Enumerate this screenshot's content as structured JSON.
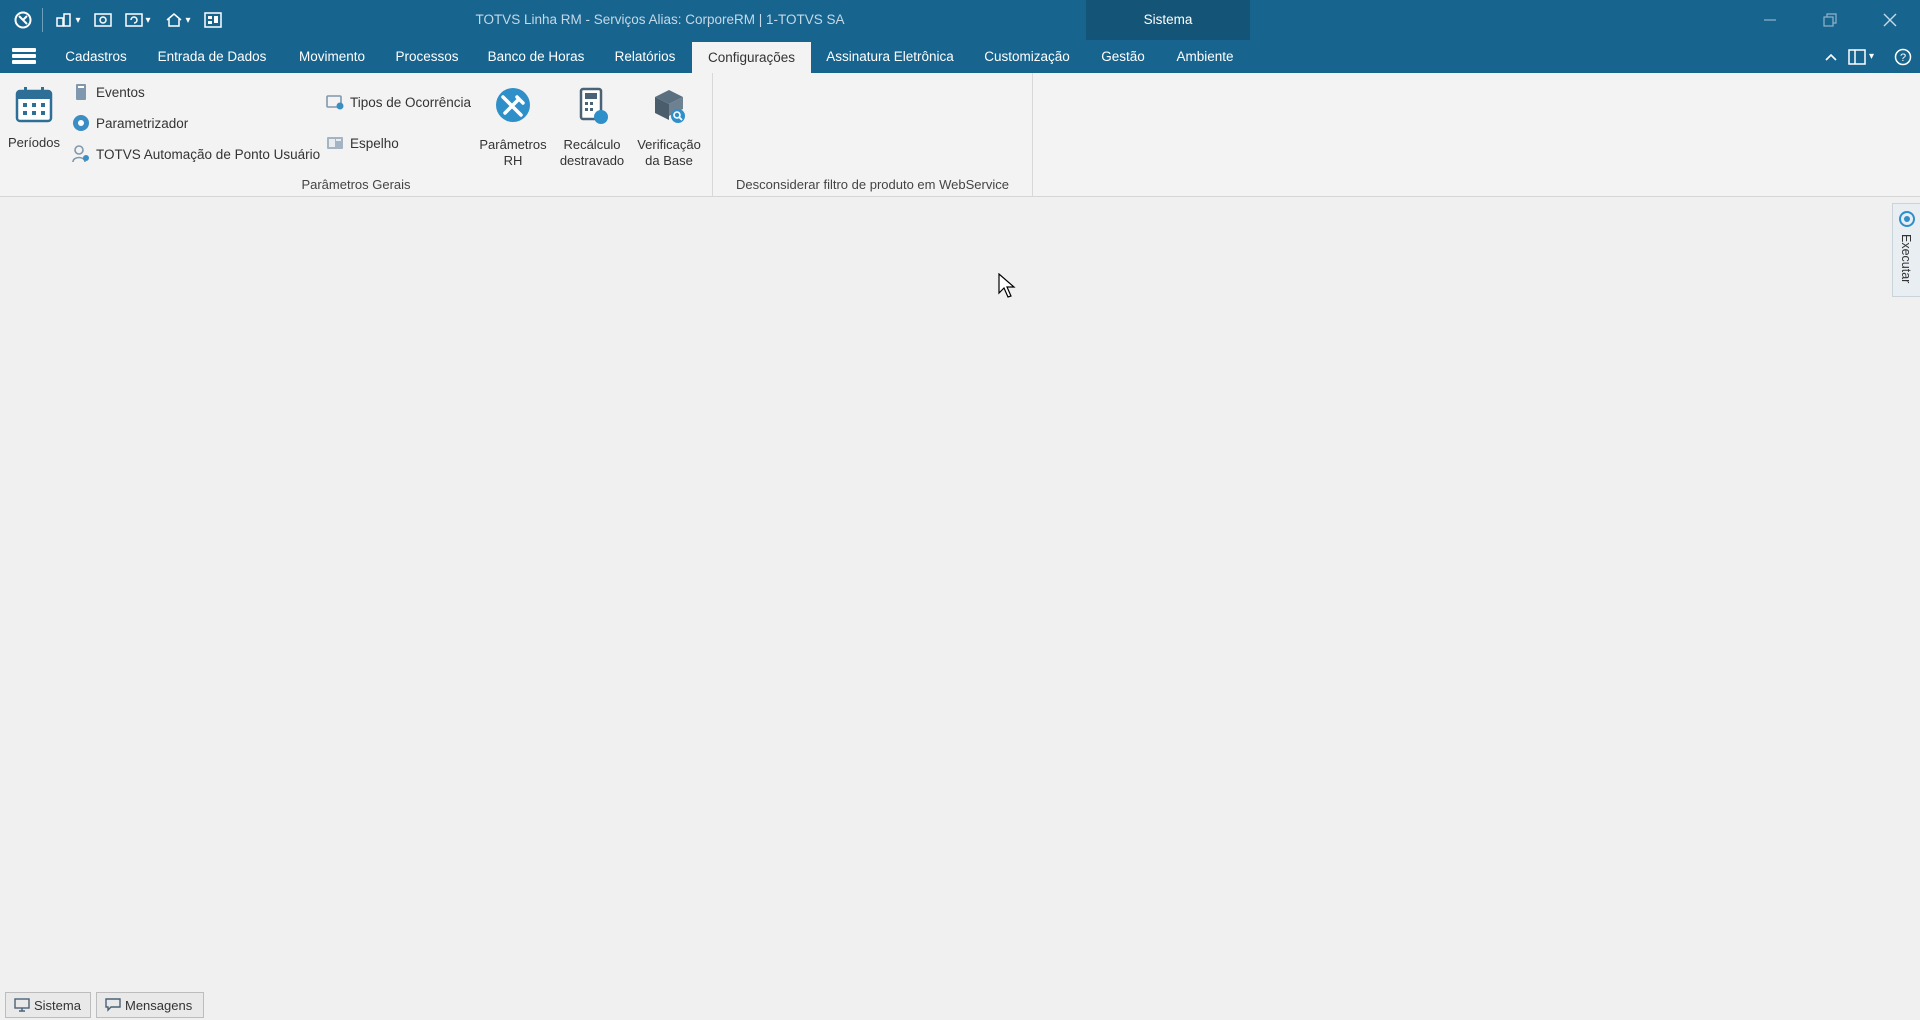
{
  "window": {
    "title": "TOTVS Linha RM - Serviços  Alias: CorporeRM | 1-TOTVS SA",
    "context_group": "Sistema"
  },
  "tabs": [
    {
      "label": "Cadastros"
    },
    {
      "label": "Entrada de Dados"
    },
    {
      "label": "Movimento"
    },
    {
      "label": "Processos"
    },
    {
      "label": "Banco de Horas"
    },
    {
      "label": "Relatórios"
    },
    {
      "label": "Configurações",
      "active": true
    },
    {
      "label": "Assinatura Eletrônica"
    },
    {
      "label": "Customização"
    },
    {
      "label": "Gestão"
    },
    {
      "label": "Ambiente"
    }
  ],
  "ribbon": {
    "periodos": "Períodos",
    "eventos": "Eventos",
    "parametrizador": "Parametrizador",
    "automacao": "TOTVS Automação de Ponto Usuário",
    "tipos_ocorrencia": "Tipos de Ocorrência",
    "espelho": "Espelho",
    "parametros_rh": [
      "Parâmetros",
      "RH"
    ],
    "recalculo": [
      "Recálculo",
      "destravado"
    ],
    "verificacao": [
      "Verificação",
      "da Base"
    ],
    "group_parametros_gerais": "Parâmetros Gerais",
    "group_webservice": "Desconsiderar filtro de produto em WebService"
  },
  "side_panel": {
    "executar": "Executar"
  },
  "statusbar": {
    "sistema": "Sistema",
    "mensagens": "Mensagens"
  },
  "colors": {
    "title_bar": "#17648f",
    "context_group": "#145577",
    "ribbon_bg": "#f3f3f3",
    "workspace_bg": "#f0f0f0"
  }
}
